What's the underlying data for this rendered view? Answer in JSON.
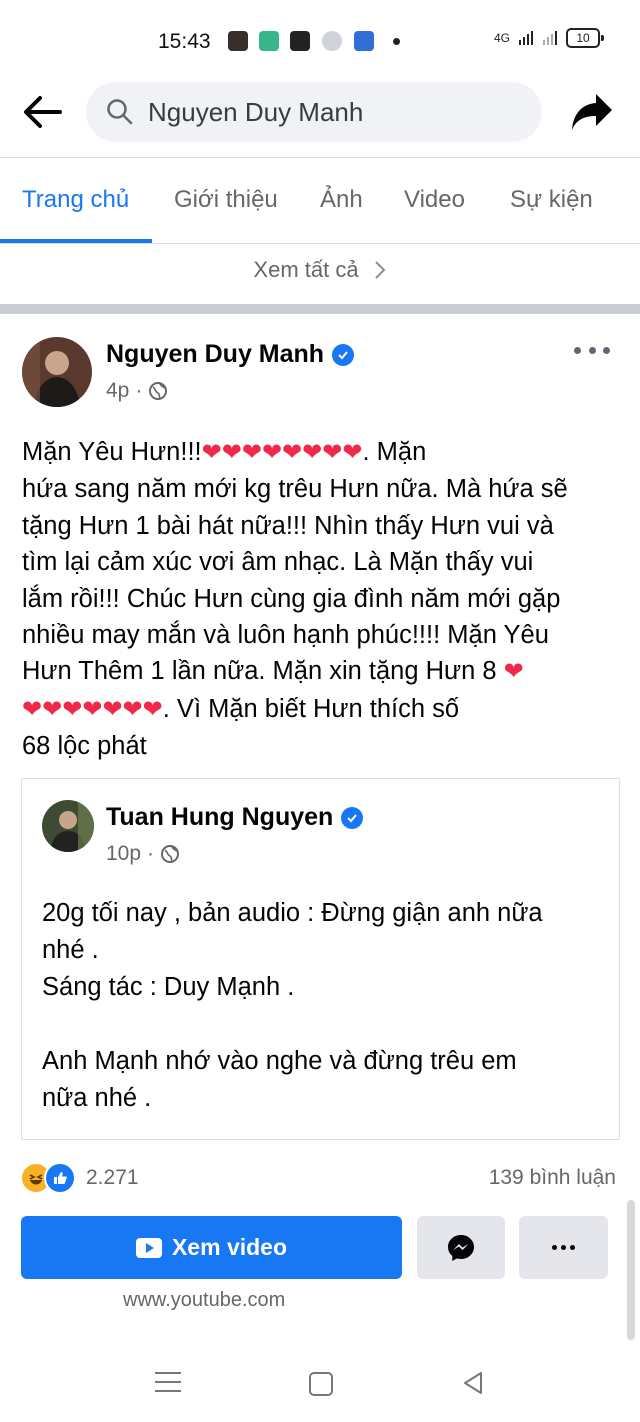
{
  "status_bar": {
    "time": "15:43",
    "network": "4G",
    "battery": "10"
  },
  "header": {
    "search_value": "Nguyen Duy Manh"
  },
  "tabs": [
    {
      "label": "Trang chủ",
      "active": true
    },
    {
      "label": "Giới thiệu",
      "active": false
    },
    {
      "label": "Ảnh",
      "active": false
    },
    {
      "label": "Video",
      "active": false
    },
    {
      "label": "Sự kiện",
      "active": false
    }
  ],
  "see_all": "Xem tất cả",
  "post": {
    "author": "Nguyen Duy Manh",
    "time": "4p",
    "text_lines": [
      "Mặn Yêu Hưn!!!",
      ". Mặn",
      "hứa sang năm mới kg trêu Hưn nữa. Mà hứa sẽ",
      "tặng Hưn 1 bài hát nữa!!! Nhìn thấy Hưn vui và",
      "tìm lại cảm xúc vơi âm nhạc. Là Mặn thấy vui",
      "lắm rồi!!! Chúc Hưn cùng gia đình năm mới gặp",
      "nhiều may mắn và luôn hạnh phúc!!!! Mặn Yêu",
      "Hưn Thêm 1 lần nữa. Mặn xin tặng Hưn 8",
      ". Vì Mặn biết Hưn thích số",
      "68 lộc phát"
    ],
    "hearts_line1": "❤❤❤❤❤❤❤❤",
    "hearts_line7": "❤",
    "hearts_line8": "❤❤❤❤❤❤❤"
  },
  "shared_post": {
    "author": "Tuan Hung Nguyen",
    "time": "10p",
    "text_lines": [
      "20g tối nay , bản audio :  Đừng giận anh nữa",
      "nhé .",
      "Sáng tác : Duy Mạnh .",
      "",
      "Anh Mạnh nhớ vào nghe và đừng trêu em",
      "nữa nhé ."
    ]
  },
  "engagement": {
    "reaction_count": "2.271",
    "comments": "139 bình luận"
  },
  "actions": {
    "watch_video": "Xem video",
    "link": "www.youtube.com"
  },
  "colors": {
    "accent": "#1877f2",
    "heart": "#f0284a"
  }
}
